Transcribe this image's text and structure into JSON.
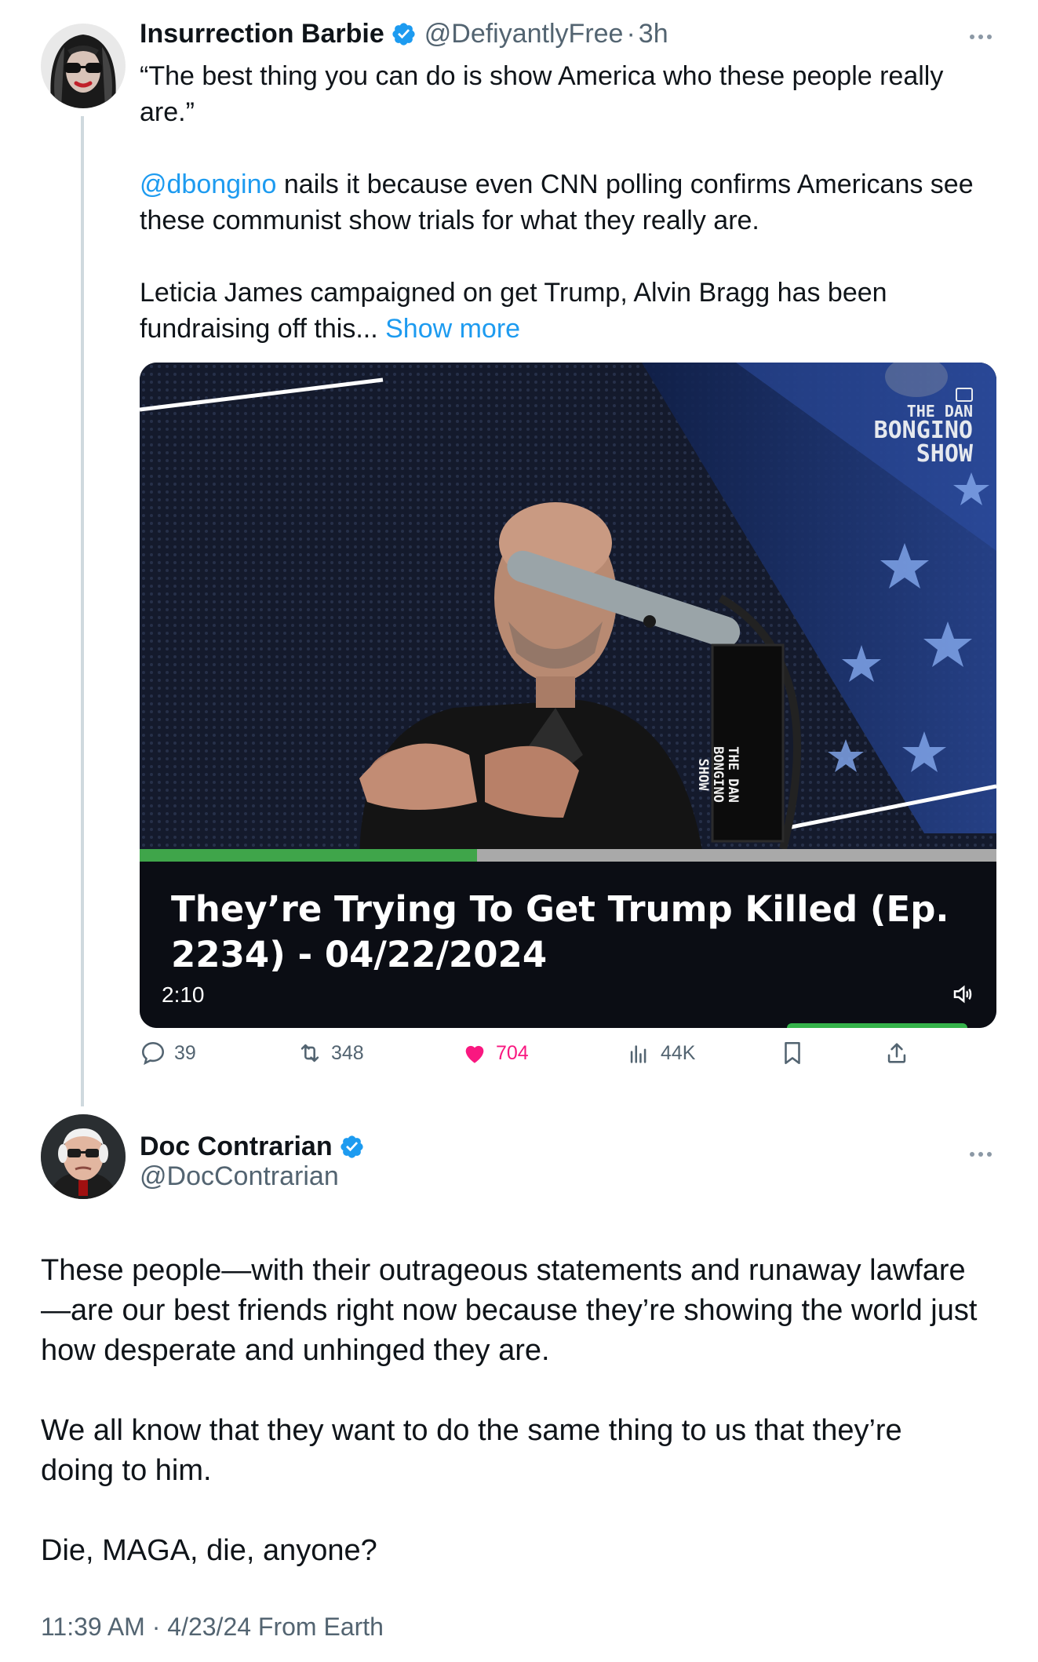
{
  "first_tweet": {
    "display_name": "Insurrection Barbie",
    "handle": "@DefiyantlyFree",
    "separator": "·",
    "time_ago": "3h",
    "text_line_1a": "“The best thing you can do is show America who these people really",
    "text_line_1b": "are.”",
    "mention": "@dbongino",
    "text_line_2a": " nails it because even CNN polling confirms Americans see",
    "text_line_2b": "these communist show trials for what they really are.",
    "text_line_3a": "Leticia James campaigned on get Trump, Alvin Bragg has been",
    "text_line_3b": "fundraising off this... ",
    "show_more": "Show more",
    "video": {
      "show_logo_small": "THE DAN",
      "show_logo_big1": "BONGINO",
      "show_logo_big2": "SHOW",
      "mic_label_1": "THE DAN",
      "mic_label_2": "BONGINO",
      "mic_label_3": "SHOW",
      "caption_line_1": "They’re Trying To Get Trump Killed (Ep.",
      "caption_line_2": "2234) - 04/22/2024",
      "duration": "2:10",
      "progress": 0.4
    },
    "actions": {
      "replies": "39",
      "reposts": "348",
      "likes": "704",
      "views": "44K"
    }
  },
  "second_tweet": {
    "display_name": "Doc Contrarian",
    "handle": "@DocContrarian",
    "para_1a": "These people—with their outrageous statements and runaway lawfare",
    "para_1b": "—are our best friends right now because they’re showing the world just",
    "para_1c": "how desperate and unhinged they are.",
    "para_2a": "We all know that they want to do the same thing to us that they’re",
    "para_2b": "doing to him.",
    "para_3": "Die, MAGA, die, anyone?",
    "timestamp": "11:39 AM · 4/23/24 From Earth"
  },
  "colors": {
    "link": "#1d9bf0",
    "like": "#f91880",
    "verified": "#1d9bf0",
    "muted": "#536471",
    "thread_line": "#cfd9de"
  }
}
